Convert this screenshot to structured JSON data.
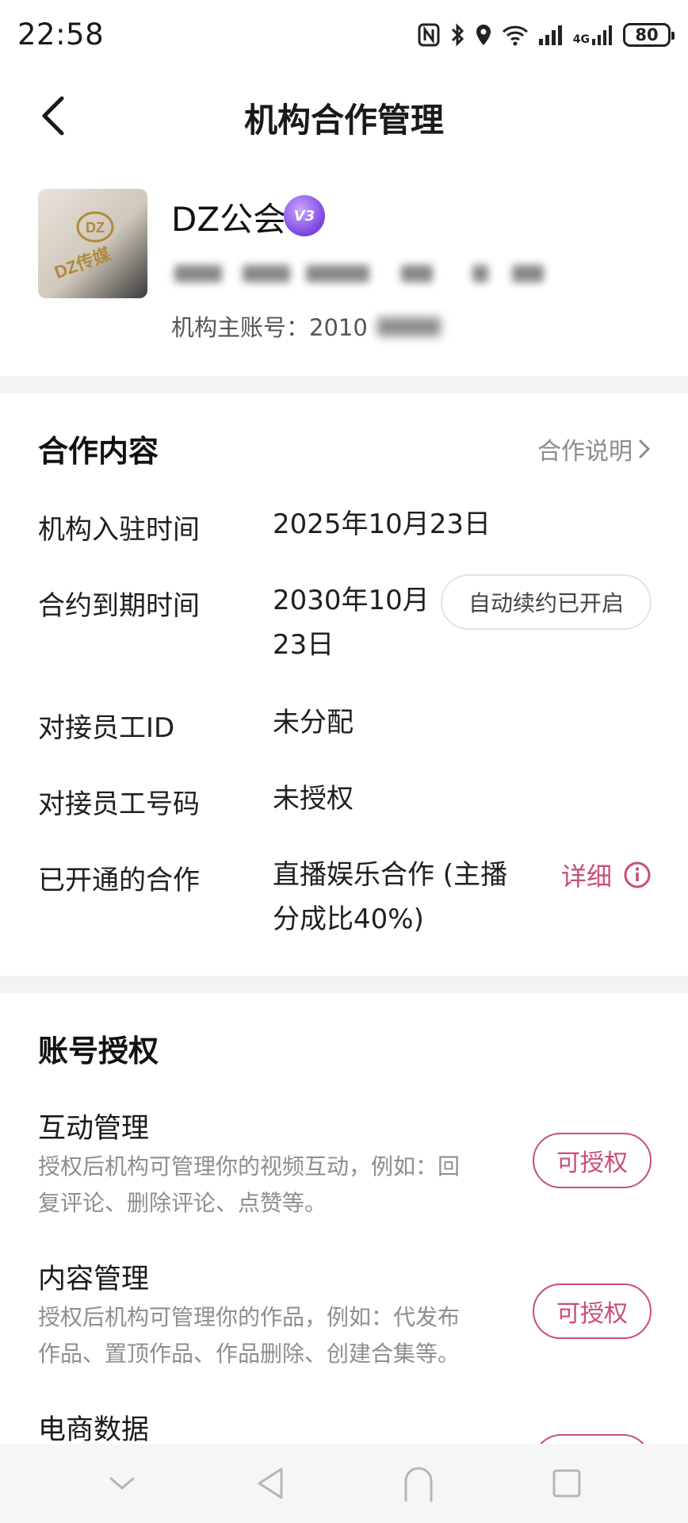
{
  "status_bar": {
    "time": "22:58",
    "battery": "80",
    "network": "4G",
    "icons": [
      "nfc-icon",
      "bluetooth-icon",
      "location-icon",
      "wifi-icon",
      "signal-icon",
      "4g-signal-icon",
      "battery-icon"
    ]
  },
  "nav": {
    "title": "机构合作管理",
    "back_icon": "chevron-left-icon"
  },
  "org": {
    "name": "DZ公会",
    "level_badge": "V3",
    "owner_account": "机构主账号：2010"
  },
  "cooperation": {
    "section_title": "合作内容",
    "explain_link": "合作说明",
    "rows": [
      {
        "label": "机构入驻时间",
        "value": "2025年10月23日"
      },
      {
        "label": "合约到期时间",
        "value_line1": "2030年10月",
        "value_line2": "23日",
        "tag": "自动续约已开启"
      },
      {
        "label": "对接员工ID",
        "value": "未分配"
      },
      {
        "label": "对接员工号码",
        "value": "未授权"
      },
      {
        "label": "已开通的合作",
        "value_line1": "直播娱乐合作 (主播",
        "value_line2": "分成比40%)",
        "detail": "详细"
      }
    ]
  },
  "authorization": {
    "section_title": "账号授权",
    "items": [
      {
        "title": "互动管理",
        "desc_line1": "授权后机构可管理你的视频互动，例如：回",
        "desc_line2": "复评论、删除评论、点赞等。",
        "button": "可授权"
      },
      {
        "title": "内容管理",
        "desc_line1": "授权后机构可管理你的作品，例如：代发布",
        "desc_line2": "作品、置顶作品、作品删除、创建合集等。",
        "button": "可授权"
      },
      {
        "title": "电商数据"
      }
    ]
  },
  "colors": {
    "accent": "#c94d77",
    "muted": "#8e8e8e",
    "divider": "#f3f3f3"
  },
  "system_nav": [
    "chevron-down-icon",
    "back-triangle-icon",
    "home-arch-icon",
    "recents-square-icon"
  ]
}
